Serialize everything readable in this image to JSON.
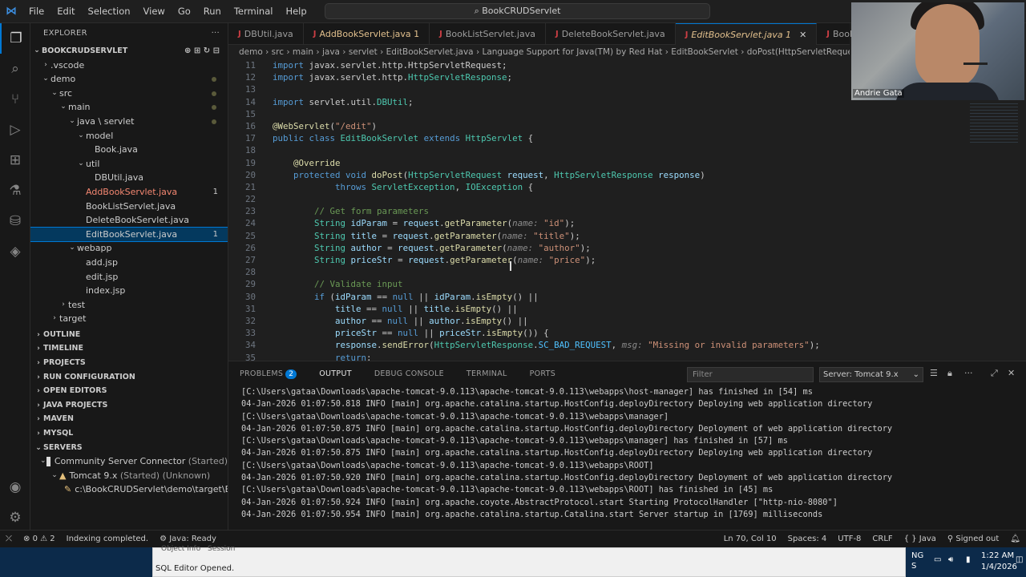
{
  "titlebar": {
    "menus": [
      "File",
      "Edit",
      "Selection",
      "View",
      "Go",
      "Run",
      "Terminal",
      "Help"
    ],
    "search": "BookCRUDServlet"
  },
  "sidebar": {
    "header": "EXPLORER",
    "root": "BOOKCRUDSERVLET",
    "tree": [
      {
        "label": ".vscode",
        "depth": 1,
        "chev": "›",
        "color": "normal"
      },
      {
        "label": "demo",
        "depth": 1,
        "chev": "⌄",
        "color": "normal",
        "dot": true
      },
      {
        "label": "src",
        "depth": 2,
        "chev": "⌄",
        "color": "normal",
        "dot": true
      },
      {
        "label": "main",
        "depth": 3,
        "chev": "⌄",
        "color": "normal",
        "dot": true
      },
      {
        "label": "java \\ servlet",
        "depth": 4,
        "chev": "⌄",
        "color": "normal",
        "dot": true
      },
      {
        "label": "model",
        "depth": 5,
        "chev": "⌄",
        "color": "normal"
      },
      {
        "label": "Book.java",
        "depth": 6,
        "chev": "",
        "color": "normal"
      },
      {
        "label": "util",
        "depth": 5,
        "chev": "⌄",
        "color": "normal"
      },
      {
        "label": "DBUtil.java",
        "depth": 6,
        "chev": "",
        "color": "normal"
      },
      {
        "label": "AddBookServlet.java",
        "depth": 5,
        "chev": "",
        "color": "red",
        "badge": "1"
      },
      {
        "label": "BookListServlet.java",
        "depth": 5,
        "chev": "",
        "color": "normal"
      },
      {
        "label": "DeleteBookServlet.java",
        "depth": 5,
        "chev": "",
        "color": "normal"
      },
      {
        "label": "EditBookServlet.java",
        "depth": 5,
        "chev": "",
        "color": "normal",
        "badge": "1",
        "selected": true
      },
      {
        "label": "webapp",
        "depth": 4,
        "chev": "⌄",
        "color": "normal"
      },
      {
        "label": "add.jsp",
        "depth": 5,
        "chev": "",
        "color": "normal"
      },
      {
        "label": "edit.jsp",
        "depth": 5,
        "chev": "",
        "color": "normal"
      },
      {
        "label": "index.jsp",
        "depth": 5,
        "chev": "",
        "color": "normal"
      },
      {
        "label": "test",
        "depth": 3,
        "chev": "›",
        "color": "normal"
      },
      {
        "label": "target",
        "depth": 2,
        "chev": "›",
        "color": "normal"
      }
    ],
    "sections": [
      "OUTLINE",
      "TIMELINE",
      "PROJECTS",
      "RUN CONFIGURATION",
      "OPEN EDITORS",
      "JAVA PROJECTS",
      "MAVEN",
      "MYSQL"
    ],
    "servers": {
      "title": "SERVERS",
      "connector": "Community Server Connector",
      "connector_state": "(Started)",
      "tomcat": "Tomcat 9.x",
      "tomcat_state": "(Started) (Unknown)",
      "deploy": "c:\\BookCRUDServlet\\demo\\target\\Bo..."
    }
  },
  "tabs": [
    {
      "label": "DBUtil.java",
      "state": "normal"
    },
    {
      "label": "AddBookServlet.java 1",
      "state": "mod"
    },
    {
      "label": "BookListServlet.java",
      "state": "normal"
    },
    {
      "label": "DeleteBookServlet.java",
      "state": "normal"
    },
    {
      "label": "EditBookServlet.java 1",
      "state": "active"
    },
    {
      "label": "Book.java",
      "state": "normal"
    }
  ],
  "breadcrumb": "demo › src › main › java › servlet › EditBookServlet.java › Language Support for Java(TM) by Red Hat › EditBookServlet › doPost(HttpServletRequest, Htt",
  "editor": {
    "lines": [
      {
        "n": "11",
        "html": "<span class='kw'>import</span> javax.servlet.http.HttpServletRequest;"
      },
      {
        "n": "12",
        "html": "<span class='kw'>import</span> javax.servlet.http.<span class='ty'>HttpServletResponse</span>;"
      },
      {
        "n": "13",
        "html": ""
      },
      {
        "n": "14",
        "html": "<span class='kw'>import</span> servlet.util.<span class='ty'>DBUtil</span>;"
      },
      {
        "n": "15",
        "html": ""
      },
      {
        "n": "16",
        "html": "<span class='an'>@WebServlet</span>(<span class='st'>\"/edit\"</span>)"
      },
      {
        "n": "17",
        "html": "<span class='kw'>public class</span> <span class='ty'>EditBookServlet</span> <span class='kw'>extends</span> <span class='ty'>HttpServlet</span> {"
      },
      {
        "n": "18",
        "html": ""
      },
      {
        "n": "19",
        "html": "    <span class='an'>@Override</span>"
      },
      {
        "n": "20",
        "html": "    <span class='kw'>protected void</span> <span class='fn'>doPost</span>(<span class='ty'>HttpServletRequest</span> <span class='pv'>request</span>, <span class='ty'>HttpServletResponse</span> <span class='pv'>response</span>)"
      },
      {
        "n": "21",
        "html": "            <span class='kw'>throws</span> <span class='ty'>ServletException</span>, <span class='ty'>IOException</span> {"
      },
      {
        "n": "22",
        "html": ""
      },
      {
        "n": "23",
        "html": "        <span class='cm'>// Get form parameters</span>"
      },
      {
        "n": "24",
        "html": "        <span class='ty'>String</span> <span class='pv'>idParam</span> = <span class='pv'>request</span>.<span class='fn'>getParameter</span>(<span class='hint'>name:</span> <span class='st'>\"id\"</span>);"
      },
      {
        "n": "25",
        "html": "        <span class='ty'>String</span> <span class='pv'>title</span> = <span class='pv'>request</span>.<span class='fn'>getParameter</span>(<span class='hint'>name:</span> <span class='st'>\"title\"</span>);"
      },
      {
        "n": "26",
        "html": "        <span class='ty'>String</span> <span class='pv'>author</span> = <span class='pv'>request</span>.<span class='fn'>getParameter</span>(<span class='hint'>name:</span> <span class='st'>\"author\"</span>);"
      },
      {
        "n": "27",
        "html": "        <span class='ty'>String</span> <span class='pv'>priceStr</span> = <span class='pv'>request</span>.<span class='fn'>getParameter</span>(<span class='hint'>name:</span> <span class='st'>\"price\"</span>);"
      },
      {
        "n": "28",
        "html": ""
      },
      {
        "n": "29",
        "html": "        <span class='cm'>// Validate input</span>"
      },
      {
        "n": "30",
        "html": "        <span class='kw'>if</span> (<span class='pv'>idParam</span> == <span class='kw'>null</span> || <span class='pv'>idParam</span>.<span class='fn'>isEmpty</span>() ||"
      },
      {
        "n": "31",
        "html": "            <span class='pv'>title</span> == <span class='kw'>null</span> || <span class='pv'>title</span>.<span class='fn'>isEmpty</span>() ||"
      },
      {
        "n": "32",
        "html": "            <span class='pv'>author</span> == <span class='kw'>null</span> || <span class='pv'>author</span>.<span class='fn'>isEmpty</span>() ||"
      },
      {
        "n": "33",
        "html": "            <span class='pv'>priceStr</span> == <span class='kw'>null</span> || <span class='pv'>priceStr</span>.<span class='fn'>isEmpty</span>()) {"
      },
      {
        "n": "34",
        "html": "            <span class='pv'>response</span>.<span class='fn'>sendError</span>(<span class='ty'>HttpServletResponse</span>.<span class='cn'>SC_BAD_REQUEST</span>, <span class='hint'>msg:</span> <span class='st'>\"Missing or invalid parameters\"</span>);"
      },
      {
        "n": "35",
        "html": "            <span class='kw'>return</span>;"
      }
    ]
  },
  "panel": {
    "tabs": [
      {
        "label": "PROBLEMS",
        "badge": "2"
      },
      {
        "label": "OUTPUT",
        "active": true
      },
      {
        "label": "DEBUG CONSOLE"
      },
      {
        "label": "TERMINAL"
      },
      {
        "label": "PORTS"
      }
    ],
    "filter_placeholder": "Filter",
    "server_select": "Server: Tomcat 9.x",
    "output": [
      "[C:\\Users\\gataa\\Downloads\\apache-tomcat-9.0.113\\apache-tomcat-9.0.113\\webapps\\host-manager] has finished in [54] ms",
      "04-Jan-2026 01:07:50.818 INFO [main] org.apache.catalina.startup.HostConfig.deployDirectory Deploying web application directory",
      "[C:\\Users\\gataa\\Downloads\\apache-tomcat-9.0.113\\apache-tomcat-9.0.113\\webapps\\manager]",
      "04-Jan-2026 01:07:50.875 INFO [main] org.apache.catalina.startup.HostConfig.deployDirectory Deployment of web application directory",
      "[C:\\Users\\gataa\\Downloads\\apache-tomcat-9.0.113\\apache-tomcat-9.0.113\\webapps\\manager] has finished in [57] ms",
      "04-Jan-2026 01:07:50.875 INFO [main] org.apache.catalina.startup.HostConfig.deployDirectory Deploying web application directory",
      "[C:\\Users\\gataa\\Downloads\\apache-tomcat-9.0.113\\apache-tomcat-9.0.113\\webapps\\ROOT]",
      "04-Jan-2026 01:07:50.920 INFO [main] org.apache.catalina.startup.HostConfig.deployDirectory Deployment of web application directory",
      "[C:\\Users\\gataa\\Downloads\\apache-tomcat-9.0.113\\apache-tomcat-9.0.113\\webapps\\ROOT] has finished in [45] ms",
      "04-Jan-2026 01:07:50.924 INFO [main] org.apache.coyote.AbstractProtocol.start Starting ProtocolHandler [\"http-nio-8080\"]",
      "04-Jan-2026 01:07:50.954 INFO [main] org.apache.catalina.startup.Catalina.start Server startup in [1769] milliseconds"
    ]
  },
  "statusbar": {
    "errors": "0",
    "warnings": "2",
    "indexing": "Indexing completed.",
    "java": "Java: Ready",
    "position": "Ln 70, Col 10",
    "spaces": "Spaces: 4",
    "encoding": "UTF-8",
    "eol": "CRLF",
    "language": "Java",
    "account": "Signed out"
  },
  "overlay": {
    "sql_tabs": [
      "Object Info",
      "Session"
    ],
    "sql_message": "SQL Editor Opened.",
    "tray_lang": "NG",
    "tray_lang2": "S",
    "time": "1:22 AM",
    "date": "1/4/2026",
    "webcam_name": "Andrie Gata"
  }
}
